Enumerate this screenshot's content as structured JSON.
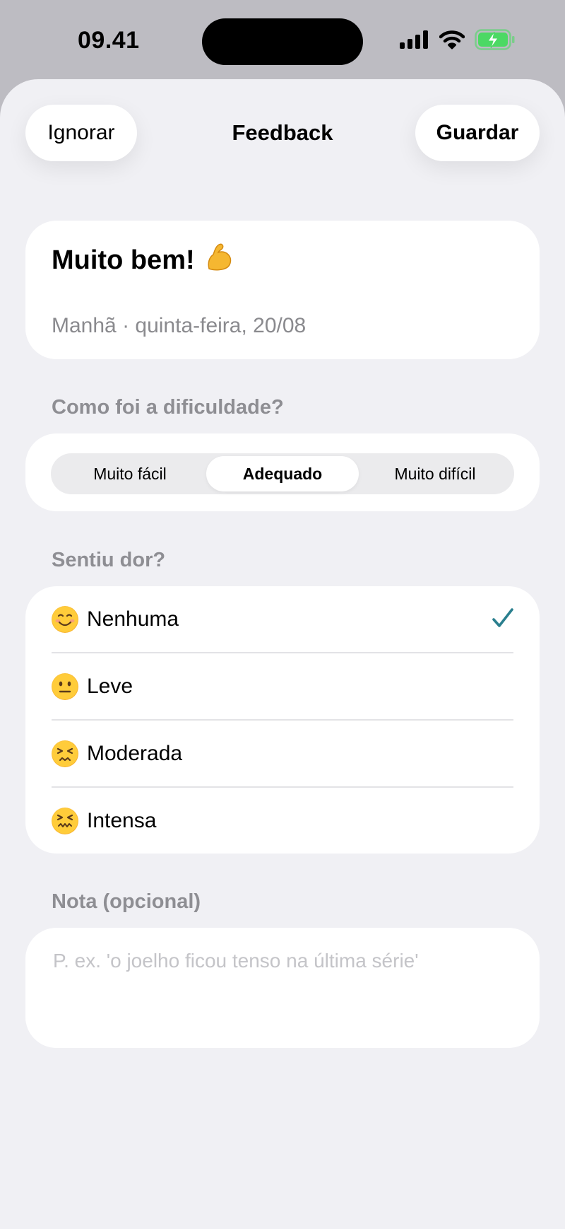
{
  "status_bar": {
    "time": "09.41",
    "icons": [
      "signal-icon",
      "wifi-icon",
      "battery-charging-icon"
    ],
    "battery_color": "#4cd964"
  },
  "nav": {
    "left_button": "Ignorar",
    "title": "Feedback",
    "right_button": "Guardar"
  },
  "summary": {
    "title": "Muito bem!",
    "title_icon": "flexed-biceps-icon",
    "subtitle": "Manhã · quinta-feira, 20/08"
  },
  "difficulty": {
    "label": "Como foi a dificuldade?",
    "options": [
      "Muito fácil",
      "Adequado",
      "Muito difícil"
    ],
    "selected": "Adequado"
  },
  "pain": {
    "label": "Sentiu dor?",
    "options": [
      {
        "label": "Nenhuma",
        "icon": "smiling-face-icon",
        "selected": true
      },
      {
        "label": "Leve",
        "icon": "neutral-face-icon",
        "selected": false
      },
      {
        "label": "Moderada",
        "icon": "persevering-face-icon",
        "selected": false
      },
      {
        "label": "Intensa",
        "icon": "confounded-face-icon",
        "selected": false
      }
    ],
    "check_color": "#2a7f8e"
  },
  "note": {
    "label": "Nota (opcional)",
    "value": "",
    "placeholder": "P. ex. 'o joelho ficou tenso na última série'"
  }
}
